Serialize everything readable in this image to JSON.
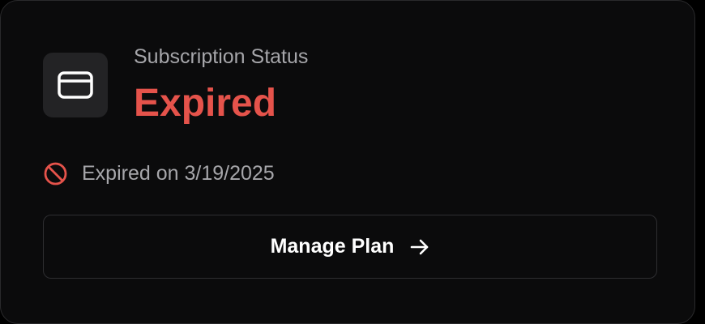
{
  "subscription": {
    "heading": "Subscription Status",
    "status": "Expired",
    "expiry_text": "Expired on 3/19/2025",
    "action_label": "Manage Plan"
  },
  "icons": {
    "tile_icon": "credit-card-icon",
    "expiry_icon": "prohibited-icon",
    "action_icon": "arrow-right-icon"
  },
  "colors": {
    "status": "#e5534b",
    "muted_text": "#a6a6aa",
    "background": "#0b0b0c"
  }
}
